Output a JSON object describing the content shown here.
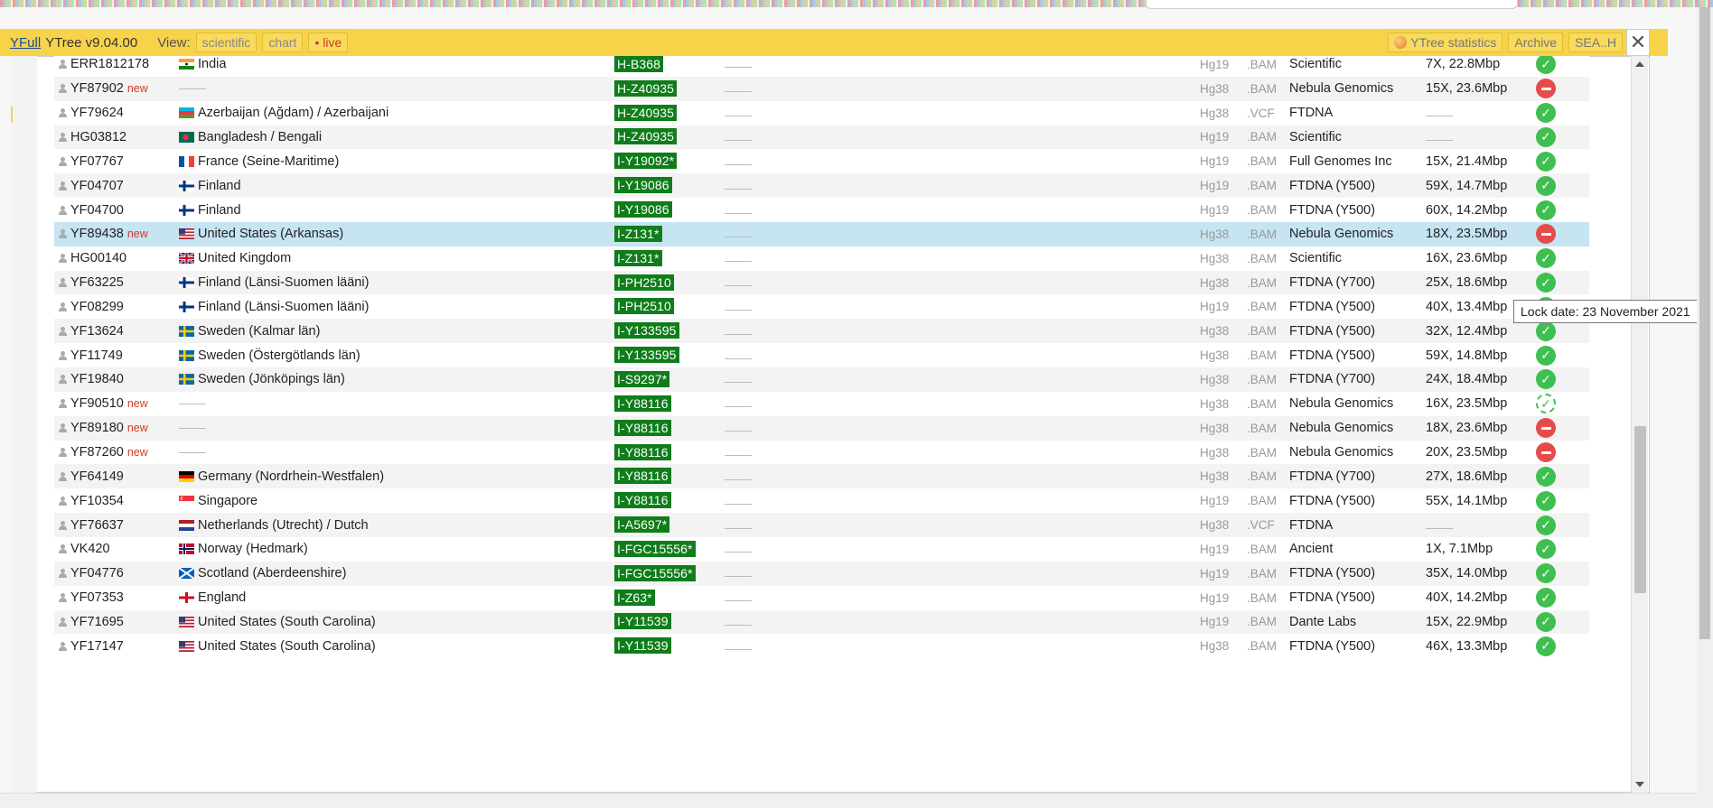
{
  "topbar": {
    "brand": "YFull",
    "version": "YTree v9.04.00",
    "view_label": "View:",
    "view_buttons": [
      "scientific",
      "chart",
      "• live"
    ],
    "right_buttons": [
      "YTree statistics",
      "Archive",
      "SEA..H"
    ]
  },
  "tooltip": "Lock date: 23 November 2021",
  "colors": {
    "accent_bar": "#f7d34a",
    "haplogroup_bg": "#0f7d1a",
    "status_ok": "#3fbf4f",
    "status_rejected": "#e54b4b",
    "highlight_row": "#c6e4f2",
    "new_tag": "#d03a2a"
  },
  "rows": [
    {
      "id": "ERR1812178",
      "new": "",
      "flag": "india",
      "country": "India",
      "hap": "H-B368",
      "ref": "Hg19",
      "fmt": ".BAM",
      "lab": "Scientific",
      "cov": "7X, 22.8Mbp",
      "status": "ok"
    },
    {
      "id": "YF87902",
      "new": "new",
      "flag": "",
      "country": "",
      "hap": "H-Z40935",
      "ref": "Hg38",
      "fmt": ".BAM",
      "lab": "Nebula Genomics",
      "cov": "15X, 23.6Mbp",
      "status": "no"
    },
    {
      "id": "YF79624",
      "new": "",
      "flag": "azerbaijan",
      "country": "Azerbaijan (Ağdam) / Azerbaijani",
      "hap": "H-Z40935",
      "ref": "Hg38",
      "fmt": ".VCF",
      "lab": "FTDNA",
      "cov": "",
      "status": "ok"
    },
    {
      "id": "HG03812",
      "new": "",
      "flag": "bangladesh",
      "country": "Bangladesh / Bengali",
      "hap": "H-Z40935",
      "ref": "Hg19",
      "fmt": ".BAM",
      "lab": "Scientific",
      "cov": "",
      "status": "ok"
    },
    {
      "id": "YF07767",
      "new": "",
      "flag": "france",
      "country": "France (Seine-Maritime)",
      "hap": "I-Y19092*",
      "ref": "Hg19",
      "fmt": ".BAM",
      "lab": "Full Genomes Inc",
      "cov": "15X, 21.4Mbp",
      "status": "ok"
    },
    {
      "id": "YF04707",
      "new": "",
      "flag": "finland",
      "country": "Finland",
      "hap": "I-Y19086",
      "ref": "Hg19",
      "fmt": ".BAM",
      "lab": "FTDNA (Y500)",
      "cov": "59X, 14.7Mbp",
      "status": "ok"
    },
    {
      "id": "YF04700",
      "new": "",
      "flag": "finland",
      "country": "Finland",
      "hap": "I-Y19086",
      "ref": "Hg19",
      "fmt": ".BAM",
      "lab": "FTDNA (Y500)",
      "cov": "60X, 14.2Mbp",
      "status": "ok"
    },
    {
      "id": "YF89438",
      "new": "new",
      "flag": "usa",
      "country": "United States (Arkansas)",
      "hap": "I-Z131*",
      "ref": "Hg38",
      "fmt": ".BAM",
      "lab": "Nebula Genomics",
      "cov": "18X, 23.5Mbp",
      "status": "no"
    },
    {
      "id": "HG00140",
      "new": "",
      "flag": "uk",
      "country": "United Kingdom",
      "hap": "I-Z131*",
      "ref": "Hg38",
      "fmt": ".BAM",
      "lab": "Scientific",
      "cov": "16X, 23.6Mbp",
      "status": "ok"
    },
    {
      "id": "YF63225",
      "new": "",
      "flag": "finland",
      "country": "Finland (Länsi-Suomen lääni)",
      "hap": "I-PH2510",
      "ref": "Hg38",
      "fmt": ".BAM",
      "lab": "FTDNA (Y700)",
      "cov": "25X, 18.6Mbp",
      "status": "ok"
    },
    {
      "id": "YF08299",
      "new": "",
      "flag": "finland",
      "country": "Finland (Länsi-Suomen lääni)",
      "hap": "I-PH2510",
      "ref": "Hg19",
      "fmt": ".BAM",
      "lab": "FTDNA (Y500)",
      "cov": "40X, 13.4Mbp",
      "status": "ok"
    },
    {
      "id": "YF13624",
      "new": "",
      "flag": "sweden",
      "country": "Sweden (Kalmar län)",
      "hap": "I-Y133595",
      "ref": "Hg38",
      "fmt": ".BAM",
      "lab": "FTDNA (Y500)",
      "cov": "32X, 12.4Mbp",
      "status": "ok"
    },
    {
      "id": "YF11749",
      "new": "",
      "flag": "sweden",
      "country": "Sweden (Östergötlands län)",
      "hap": "I-Y133595",
      "ref": "Hg38",
      "fmt": ".BAM",
      "lab": "FTDNA (Y500)",
      "cov": "59X, 14.8Mbp",
      "status": "ok"
    },
    {
      "id": "YF19840",
      "new": "",
      "flag": "sweden",
      "country": "Sweden (Jönköpings län)",
      "hap": "I-S9297*",
      "ref": "Hg38",
      "fmt": ".BAM",
      "lab": "FTDNA (Y700)",
      "cov": "24X, 18.4Mbp",
      "status": "ok"
    },
    {
      "id": "YF90510",
      "new": "new",
      "flag": "",
      "country": "",
      "hap": "I-Y88116",
      "ref": "Hg38",
      "fmt": ".BAM",
      "lab": "Nebula Genomics",
      "cov": "16X, 23.5Mbp",
      "status": "wait"
    },
    {
      "id": "YF89180",
      "new": "new",
      "flag": "",
      "country": "",
      "hap": "I-Y88116",
      "ref": "Hg38",
      "fmt": ".BAM",
      "lab": "Nebula Genomics",
      "cov": "18X, 23.6Mbp",
      "status": "no"
    },
    {
      "id": "YF87260",
      "new": "new",
      "flag": "",
      "country": "",
      "hap": "I-Y88116",
      "ref": "Hg38",
      "fmt": ".BAM",
      "lab": "Nebula Genomics",
      "cov": "20X, 23.5Mbp",
      "status": "no"
    },
    {
      "id": "YF64149",
      "new": "",
      "flag": "germany",
      "country": "Germany (Nordrhein-Westfalen)",
      "hap": "I-Y88116",
      "ref": "Hg38",
      "fmt": ".BAM",
      "lab": "FTDNA (Y700)",
      "cov": "27X, 18.6Mbp",
      "status": "ok"
    },
    {
      "id": "YF10354",
      "new": "",
      "flag": "singapore",
      "country": "Singapore",
      "hap": "I-Y88116",
      "ref": "Hg19",
      "fmt": ".BAM",
      "lab": "FTDNA (Y500)",
      "cov": "55X, 14.1Mbp",
      "status": "ok"
    },
    {
      "id": "YF76637",
      "new": "",
      "flag": "netherlands",
      "country": "Netherlands (Utrecht) / Dutch",
      "hap": "I-A5697*",
      "ref": "Hg38",
      "fmt": ".VCF",
      "lab": "FTDNA",
      "cov": "",
      "status": "ok"
    },
    {
      "id": "VK420",
      "new": "",
      "flag": "norway",
      "country": "Norway (Hedmark)",
      "hap": "I-FGC15556*",
      "ref": "Hg19",
      "fmt": ".BAM",
      "lab": "Ancient",
      "cov": "1X, 7.1Mbp",
      "status": "ok"
    },
    {
      "id": "YF04776",
      "new": "",
      "flag": "scotland",
      "country": "Scotland (Aberdeenshire)",
      "hap": "I-FGC15556*",
      "ref": "Hg19",
      "fmt": ".BAM",
      "lab": "FTDNA (Y500)",
      "cov": "35X, 14.0Mbp",
      "status": "ok"
    },
    {
      "id": "YF07353",
      "new": "",
      "flag": "england",
      "country": "England",
      "hap": "I-Z63*",
      "ref": "Hg19",
      "fmt": ".BAM",
      "lab": "FTDNA (Y500)",
      "cov": "40X, 14.2Mbp",
      "status": "ok"
    },
    {
      "id": "YF71695",
      "new": "",
      "flag": "usa",
      "country": "United States (South Carolina)",
      "hap": "I-Y11539",
      "ref": "Hg19",
      "fmt": ".BAM",
      "lab": "Dante Labs",
      "cov": "15X, 22.9Mbp",
      "status": "ok"
    },
    {
      "id": "YF17147",
      "new": "",
      "flag": "usa",
      "country": "United States (South Carolina)",
      "hap": "I-Y11539",
      "ref": "Hg38",
      "fmt": ".BAM",
      "lab": "FTDNA (Y500)",
      "cov": "46X, 13.3Mbp",
      "status": "ok"
    }
  ]
}
